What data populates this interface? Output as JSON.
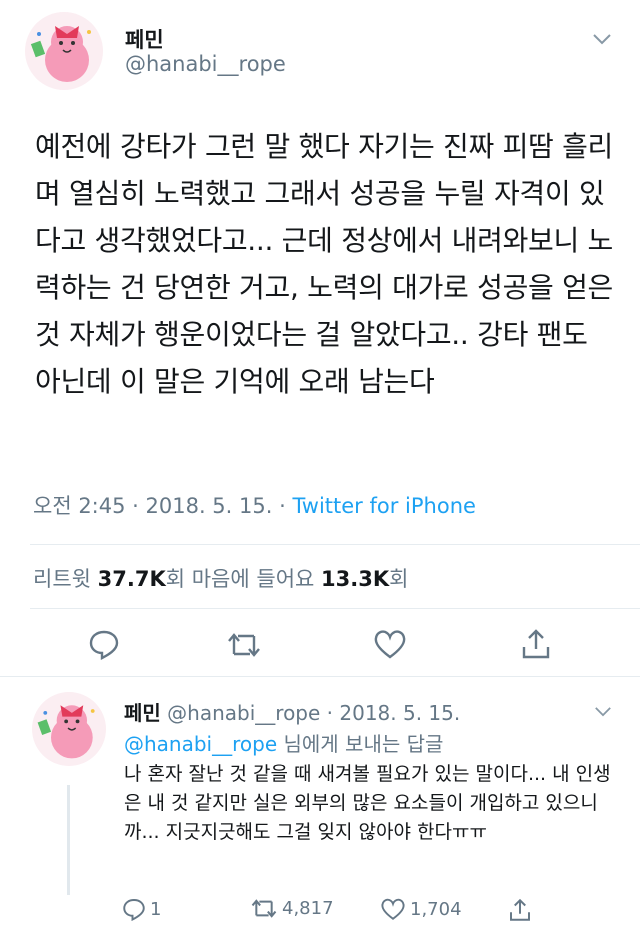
{
  "tweet": {
    "name": "페민",
    "handle": "@hanabi__rope",
    "body": "예전에 강타가 그런 말 했다 자기는 진짜 피땀 흘리며 열심히 노력했고 그래서 성공을 누릴 자격이 있다고 생각했었다고... 근데 정상에서 내려와보니 노력하는 건 당연한 거고, 노력의 대가로 성공을 얻은 것 자체가 행운이었다는 걸 알았다고.. 강타 팬도 아닌데 이 말은 기억에 오래 남는다",
    "time": "오전 2:45 · 2018. 5. 15. · ",
    "source": "Twitter for iPhone",
    "retweets_label": "리트윗 ",
    "retweets_count": "37.7K",
    "retweets_suffix": "회",
    "likes_label": "  마음에 들어요 ",
    "likes_count": "13.3K",
    "likes_suffix": "회"
  },
  "reply": {
    "name": "페민",
    "meta": " @hanabi__rope · 2018. 5. 15.",
    "mention": "@hanabi__rope",
    "to_suffix": " 님에게 보내는 답글",
    "body": "나 혼자 잘난 것 같을 때 새겨볼 필요가 있는 말이다... 내 인생은 내 것 같지만 실은 외부의 많은 요소들이 개입하고 있으니까... 지긋지긋해도 그걸 잊지 않아야 한다ㅠㅠ",
    "replies": "1",
    "retweets": "4,817",
    "likes": "1,704"
  },
  "icons": [
    "chevron-down-icon",
    "reply-icon",
    "retweet-icon",
    "like-icon",
    "share-icon"
  ],
  "colors": {
    "link": "#1da1f2",
    "muted": "#657786",
    "text": "#14171a",
    "divider": "#e6ecf0"
  }
}
